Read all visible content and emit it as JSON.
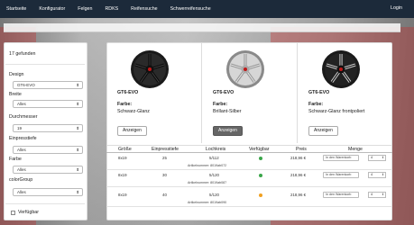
{
  "nav": {
    "items": [
      "Startseite",
      "Konfigurator",
      "Felgen",
      "RDKS",
      "Reifensuche",
      "Schwerreifensuche"
    ],
    "login": "Login"
  },
  "sidebar": {
    "count": "17 gefunden",
    "filters": [
      {
        "label": "Design",
        "value": "GT6-EVO"
      },
      {
        "label": "Breite",
        "value": "Alles"
      },
      {
        "label": "Durchmesser",
        "value": "19"
      },
      {
        "label": "Einpresstiefe",
        "value": "Alles"
      },
      {
        "label": "Farbe",
        "value": "Alles"
      },
      {
        "label": "colorGroup",
        "value": "Alles"
      }
    ],
    "availability_label": "Verfügbar"
  },
  "cards": [
    {
      "name": "GT6-EVO",
      "farbe_label": "Farbe:",
      "color": "Schwarz-Glanz",
      "button": "Anzeigen",
      "wheel": "black"
    },
    {
      "name": "GT6-EVO",
      "farbe_label": "Farbe:",
      "color": "Brillant-Silber",
      "button": "Anzeigen",
      "wheel": "silver"
    },
    {
      "name": "GT6-EVO",
      "farbe_label": "Farbe:",
      "color": "Schwarz-Glanz frontpoliert",
      "button": "Anzeigen",
      "wheel": "black-polished"
    }
  ],
  "table": {
    "headers": [
      "Größe",
      "Einpresstiefe",
      "Lochkreis",
      "Verfügbar",
      "Preis",
      "Menge"
    ],
    "rows": [
      {
        "groesse": "8x19",
        "et": "25",
        "lk": "5/112",
        "status_color": "#3aa64a",
        "preis": "218,96 €",
        "cart": "In den Warenkorb",
        "qty": "4",
        "artnr": "Artikelnummer: 8019ab072"
      },
      {
        "groesse": "8x19",
        "et": "30",
        "lk": "5/120",
        "status_color": "#3aa64a",
        "preis": "218,96 €",
        "cart": "In den Warenkorb",
        "qty": "4",
        "artnr": "Artikelnummer: 8019ab087"
      },
      {
        "groesse": "8x19",
        "et": "40",
        "lk": "5/120",
        "status_color": "#f0a020",
        "preis": "218,96 €",
        "cart": "In den Warenkorb",
        "qty": "4",
        "artnr": "Artikelnummer: 8019ab090"
      }
    ]
  }
}
